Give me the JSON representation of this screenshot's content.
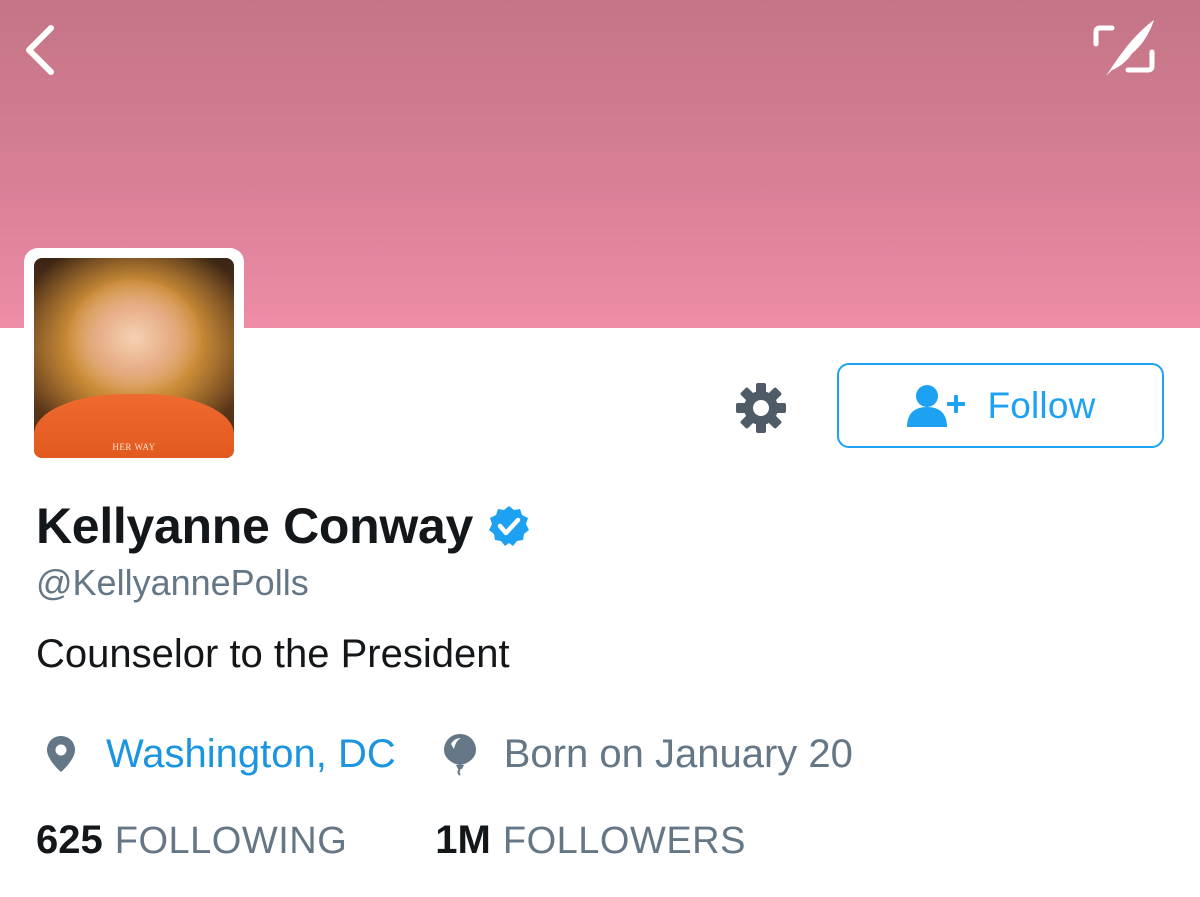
{
  "header": {
    "back_icon": "chevron-left-icon",
    "expand_icon": "compose-expand-icon",
    "banner_colors": [
      "#c37585",
      "#ef8ca6"
    ]
  },
  "profile": {
    "name": "Kellyanne Conway",
    "verified": true,
    "handle": "@KellyannePolls",
    "bio": "Counselor to the President",
    "avatar_caption": "HER WAY"
  },
  "actions": {
    "settings_icon": "gear-icon",
    "follow_label": "Follow",
    "follow_icon": "add-user-icon"
  },
  "meta": {
    "location": "Washington, DC",
    "birthday": "Born on January 20"
  },
  "stats": {
    "following_count": "625",
    "following_label": "FOLLOWING",
    "followers_count": "1M",
    "followers_label": "FOLLOWERS"
  },
  "colors": {
    "accent": "#1da1f2",
    "link": "#1b95e0",
    "muted": "#657786",
    "text": "#14171a"
  }
}
